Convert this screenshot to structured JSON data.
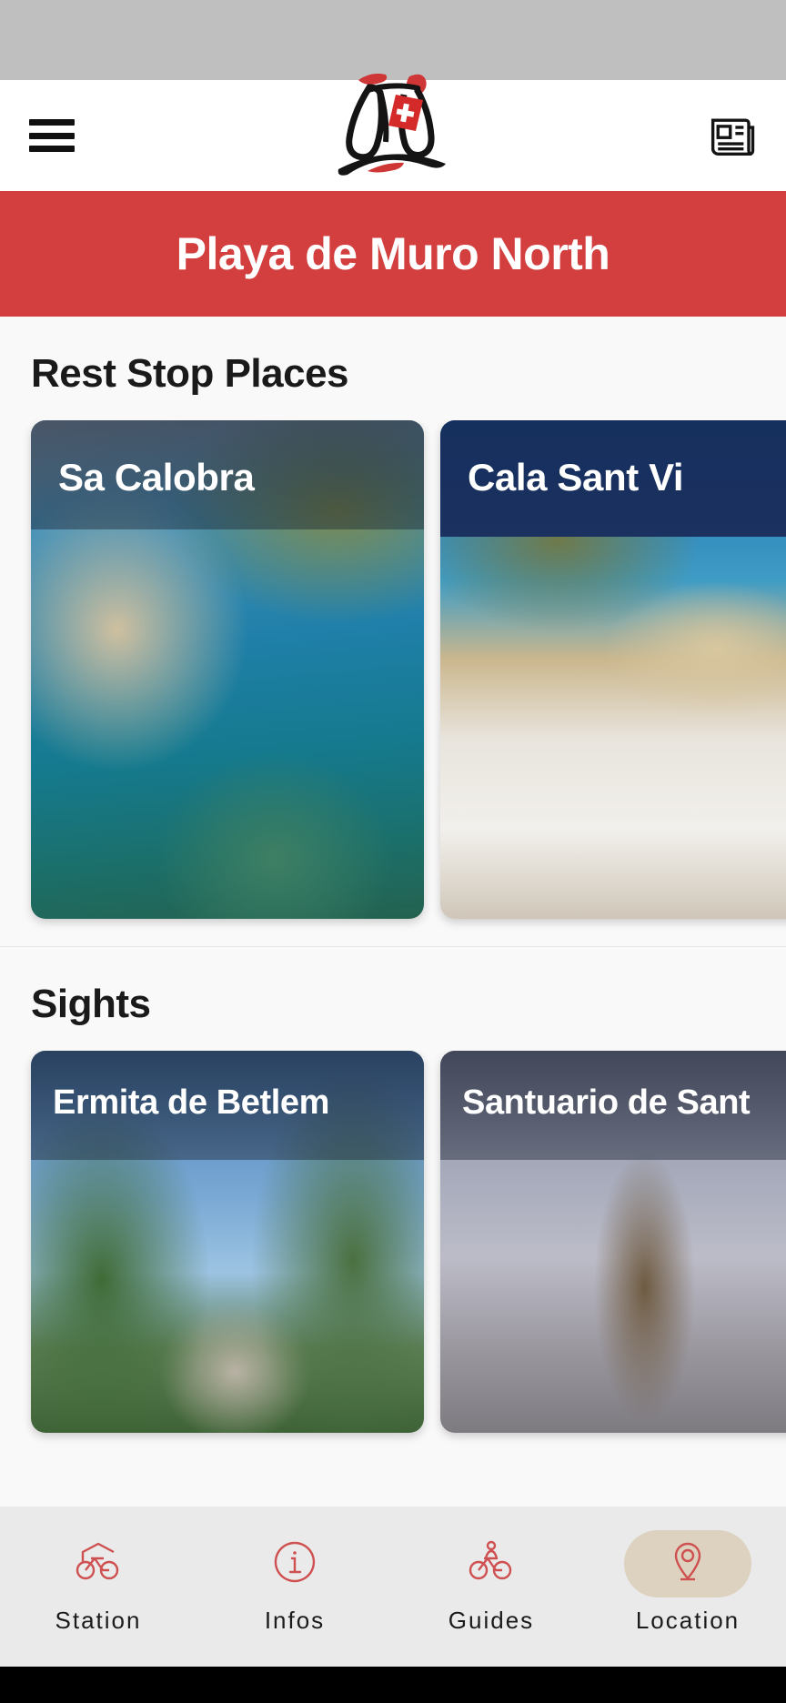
{
  "app": {
    "brand_logo_alt": "swiss-bike-logo",
    "accent_red": "#d33f3f",
    "active_pill": "#ddd2c0"
  },
  "header": {
    "menu_icon": "hamburger-menu-icon",
    "news_icon": "newspaper-icon"
  },
  "banner": {
    "title": "Playa de Muro North"
  },
  "sections": [
    {
      "heading": "Rest Stop Places",
      "cards": [
        {
          "title": "Sa Calobra",
          "photo": "p-calobra",
          "dark": false
        },
        {
          "title": "Cala Sant Vi",
          "photo": "p-calasant",
          "dark": true
        }
      ]
    },
    {
      "heading": "Sights",
      "cards": [
        {
          "title": "Ermita de Betlem",
          "photo": "p-betlem",
          "dark": false
        },
        {
          "title": "Santuario de Sant",
          "photo": "p-santuario",
          "dark": false
        }
      ]
    }
  ],
  "bottom_nav": {
    "items": [
      {
        "label": "Station",
        "icon": "bike-station-icon",
        "active": false
      },
      {
        "label": "Infos",
        "icon": "info-circle-icon",
        "active": false
      },
      {
        "label": "Guides",
        "icon": "cyclist-icon",
        "active": false
      },
      {
        "label": "Location",
        "icon": "map-pin-icon",
        "active": true
      }
    ]
  }
}
